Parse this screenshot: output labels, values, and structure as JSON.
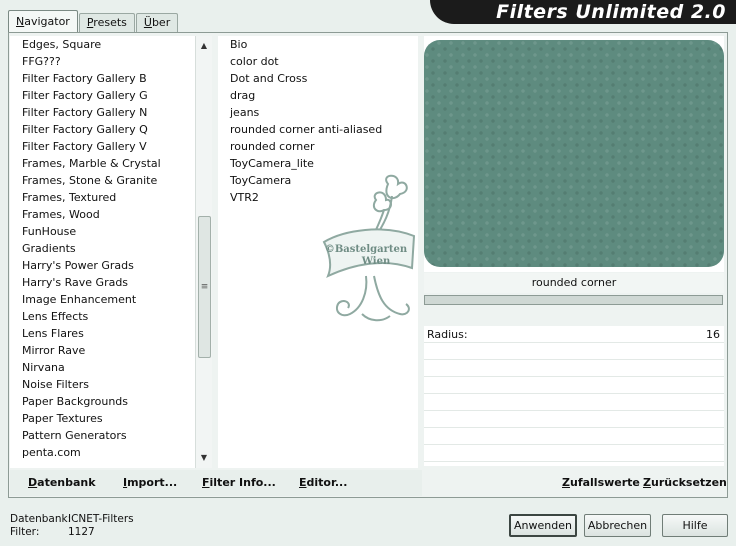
{
  "window_title": "Filters Unlimited 2.0",
  "tabs": [
    "Navigator",
    "Presets",
    "Über"
  ],
  "categories": [
    "Edges, Square",
    "FFG???",
    "Filter Factory Gallery B",
    "Filter Factory Gallery G",
    "Filter Factory Gallery N",
    "Filter Factory Gallery Q",
    "Filter Factory Gallery V",
    "Frames, Marble & Crystal",
    "Frames, Stone & Granite",
    "Frames, Textured",
    "Frames, Wood",
    "FunHouse",
    "Gradients",
    "Harry's Power Grads",
    "Harry's Rave Grads",
    "Image Enhancement",
    "Lens Effects",
    "Lens Flares",
    "Mirror Rave",
    "Nirvana",
    "Noise Filters",
    "Paper Backgrounds",
    "Paper Textures",
    "Pattern Generators",
    "penta.com"
  ],
  "filters": [
    "Bio",
    "color dot",
    "Dot and Cross",
    "drag",
    "jeans",
    "rounded corner anti-aliased",
    "rounded corner",
    "ToyCamera_lite",
    "ToyCamera",
    "VTR2"
  ],
  "selected_filter_label": "rounded corner",
  "watermark": {
    "line1": "©Bastelgarten",
    "line2": "Wien"
  },
  "params": [
    {
      "name": "Radius:",
      "value": "16"
    }
  ],
  "bottom_links": [
    "Datenbank",
    "Import...",
    "Filter Info...",
    "Editor..."
  ],
  "right_links": [
    "Zufallswerte",
    "Zurücksetzen"
  ],
  "status": {
    "db_label": "Datenbank:",
    "db_value": "ICNET-Filters",
    "filter_label": "Filter:",
    "filter_value": "1127"
  },
  "buttons": {
    "apply": "Anwenden",
    "cancel": "Abbrechen",
    "help": "Hilfe"
  },
  "colors": {
    "preview": "#5e8b7f",
    "banner": "#1b1b1b",
    "background": "#e9f0ed"
  }
}
